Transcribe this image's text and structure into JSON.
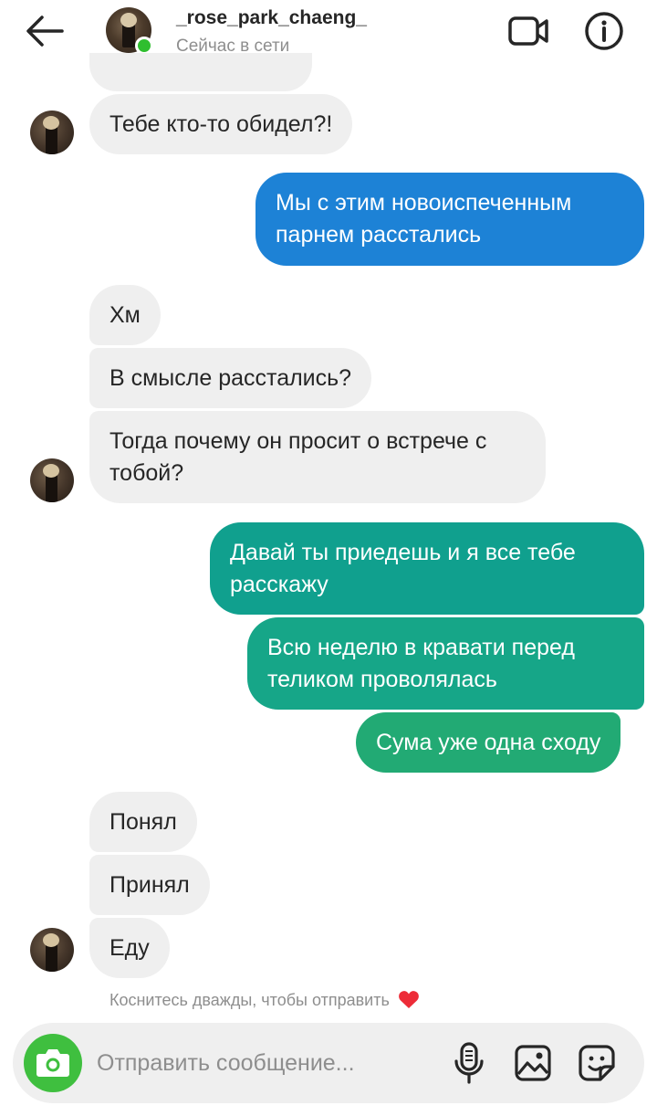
{
  "header": {
    "username": "_rose_park_chaeng_",
    "status": "Сейчас в сети"
  },
  "messages": [
    {
      "from": "them",
      "text": "Тебе кто-то обидел?!"
    },
    {
      "from": "me",
      "text": "Мы с этим новоиспеченным парнем расстались"
    },
    {
      "from": "them",
      "text": "Хм"
    },
    {
      "from": "them",
      "text": "В смысле расстались?"
    },
    {
      "from": "them",
      "text": "Тогда почему он просит о встрече с тобой?"
    },
    {
      "from": "me",
      "text": "Давай ты приедешь и я все тебе расскажу"
    },
    {
      "from": "me",
      "text": "Всю неделю в кравати перед теликом проволялась"
    },
    {
      "from": "me",
      "text": "Сума уже одна сходу"
    },
    {
      "from": "them",
      "text": "Понял"
    },
    {
      "from": "them",
      "text": "Принял"
    },
    {
      "from": "them",
      "text": "Еду"
    }
  ],
  "hint": "Коснитесь дважды, чтобы отправить",
  "composer": {
    "placeholder": "Отправить сообщение..."
  },
  "colors": {
    "incoming_bubble": "#efefef",
    "outgoing_blue": "#1d82d6",
    "outgoing_teal": "#10a08e",
    "outgoing_green": "#22aa74",
    "camera_green": "#3fbf3f",
    "online_green": "#2fbe2f",
    "heart_red": "#ed2c38"
  },
  "icons": [
    "back-arrow-icon",
    "video-camera-icon",
    "info-icon",
    "camera-icon",
    "microphone-icon",
    "gallery-icon",
    "sticker-icon",
    "heart-icon"
  ]
}
